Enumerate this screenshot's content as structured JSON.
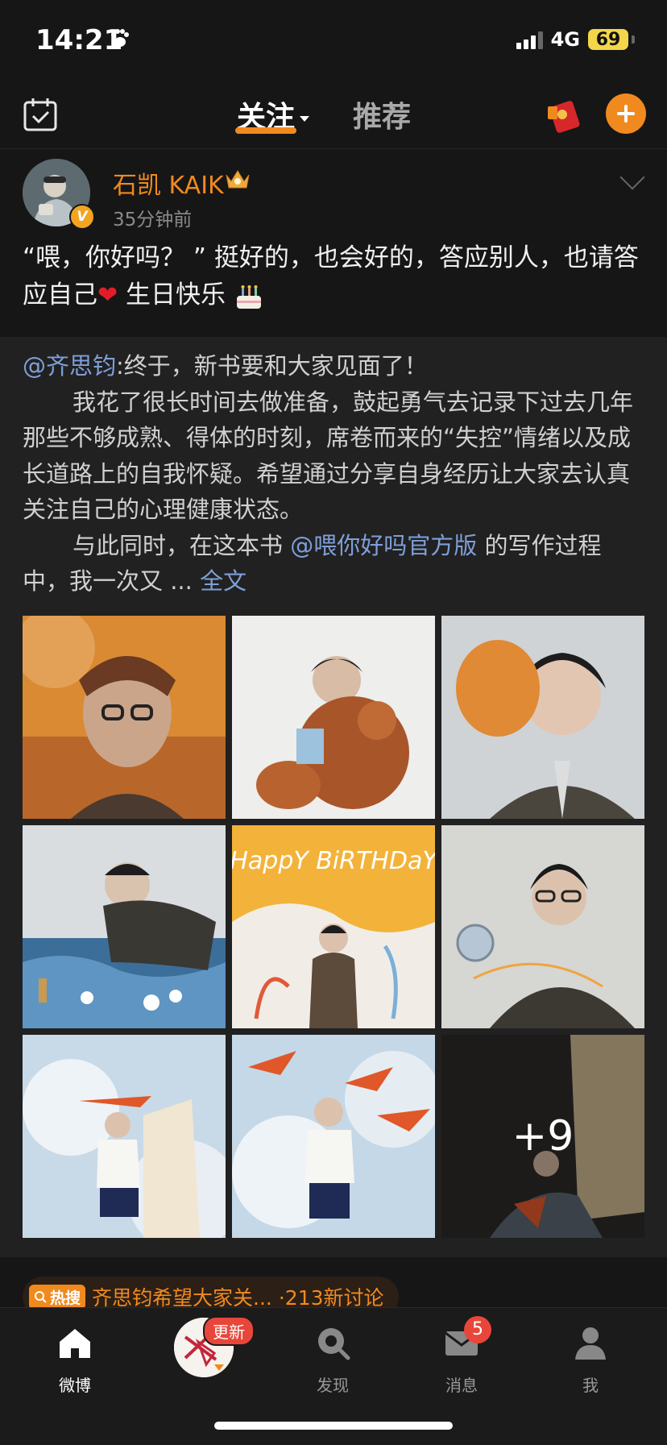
{
  "status_bar": {
    "time": "14:21",
    "network": "4G",
    "battery": "69"
  },
  "top_nav": {
    "tabs": [
      {
        "label": "关注",
        "active": true
      },
      {
        "label": "推荐",
        "active": false
      }
    ]
  },
  "post": {
    "username": "石凯 KAIK",
    "time": "35分钟前",
    "text_part1": "“喂，你好吗？ ” 挺好的，也会好的，答应别人，也请答应自己",
    "text_heart": "❤",
    "text_part2": " 生日快乐"
  },
  "repost": {
    "mention": "@齐思钧",
    "intro": ":终于，新书要和大家见面了！",
    "para1": "我花了很长时间去做准备，鼓起勇气去记录下过去几年那些不够成熟、得体的时刻，席卷而来的“失控”情绪以及成长道路上的自我怀疑。希望通过分享自身经历让大家去认真关注自己的心理健康状态。",
    "para2_a": "与此同时，在这本书",
    "para2_mention": "@喂你好吗官方版",
    "para2_b": " 的写作过程中，我一次又 ... ",
    "full_text_link": "全文",
    "photos": [
      {
        "name": "photo-1"
      },
      {
        "name": "photo-2"
      },
      {
        "name": "photo-3"
      },
      {
        "name": "photo-4"
      },
      {
        "name": "photo-5",
        "overlay_text": "HappY BiRTHDaY"
      },
      {
        "name": "photo-6"
      },
      {
        "name": "photo-7"
      },
      {
        "name": "photo-8"
      },
      {
        "name": "photo-9"
      }
    ],
    "more_count": "+9"
  },
  "hot_search": {
    "tag": "热搜",
    "text": "齐思钧希望大家关...",
    "count": "·213新讨论"
  },
  "tab_bar": {
    "items": [
      {
        "label": "微博",
        "active": true
      },
      {
        "label": "",
        "badge": "更新"
      },
      {
        "label": "发现"
      },
      {
        "label": "消息",
        "badge": "5"
      },
      {
        "label": "我"
      }
    ]
  },
  "colors": {
    "accent": "#f08a1f",
    "link": "#7e9fd9",
    "background": "#161616",
    "badge": "#e8463a"
  }
}
